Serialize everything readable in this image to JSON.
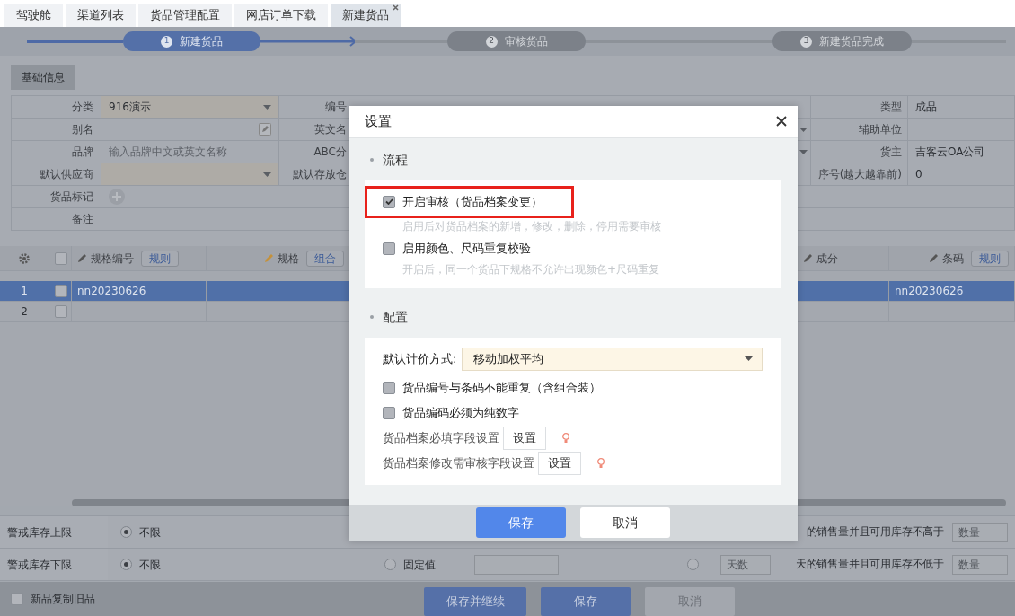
{
  "tabs": [
    {
      "label": "驾驶舱",
      "selected": false,
      "closable": false
    },
    {
      "label": "渠道列表",
      "selected": false,
      "closable": false
    },
    {
      "label": "货品管理配置",
      "selected": false,
      "closable": false
    },
    {
      "label": "网店订单下载",
      "selected": false,
      "closable": false
    },
    {
      "label": "新建货品",
      "selected": true,
      "closable": true
    }
  ],
  "steps": [
    {
      "number": "1",
      "label": "新建货品",
      "active": true
    },
    {
      "number": "2",
      "label": "审核货品",
      "active": false
    },
    {
      "number": "3",
      "label": "新建货品完成",
      "active": false
    }
  ],
  "section_tab": "基础信息",
  "form": {
    "rows": [
      {
        "label": "分类",
        "field": {
          "kind": "select",
          "value": "916演示"
        },
        "label2": "编号",
        "right_caret": false,
        "right_label": "类型",
        "right_value": "成品"
      },
      {
        "label": "别名",
        "field": {
          "kind": "edit"
        },
        "label2": "英文名",
        "right_caret": true,
        "right_label": "辅助单位"
      },
      {
        "label": "品牌",
        "field": {
          "kind": "input",
          "placeholder": "输入品牌中文或英文名称"
        },
        "label2": "ABC分",
        "right_caret": true,
        "right_label": "货主",
        "right_value": "吉客云OA公司"
      },
      {
        "label": "默认供应商",
        "field": {
          "kind": "select"
        },
        "label2": "默认存放仓",
        "right_caret": false,
        "right_label": "序号(越大越靠前)",
        "right_value": "0"
      },
      {
        "label": "货品标记",
        "field": {
          "kind": "add"
        }
      },
      {
        "label": "备注",
        "field": {
          "kind": "text"
        }
      }
    ]
  },
  "grid": {
    "select_all_checked": false,
    "columns": [
      {
        "label": "规格编号",
        "button": "规则"
      },
      {
        "label": "规格",
        "button": "组合"
      },
      {
        "label": "成分"
      },
      {
        "label": "条码",
        "button": "规则"
      }
    ],
    "rows": [
      {
        "index": "1",
        "selected": true,
        "checked": false,
        "code": "nn20230626",
        "barcode": "nn20230626"
      },
      {
        "index": "2",
        "selected": false,
        "checked": false
      }
    ]
  },
  "stock": {
    "rows": [
      {
        "label": "警戒库存上限",
        "unlimited": {
          "label": "不限",
          "selected": true
        },
        "tail": "的销售量并且可用库存不高于",
        "qty_placeholder": "数量"
      },
      {
        "label": "警戒库存下限",
        "unlimited": {
          "label": "不限",
          "selected": true
        },
        "fixed": {
          "label": "固定值",
          "selected": false
        },
        "days": {
          "selected": false,
          "placeholder": "天数"
        },
        "tail": "天的销售量并且可用库存不低于",
        "qty_placeholder": "数量"
      }
    ]
  },
  "footer": {
    "copy_old": {
      "label": "新品复制旧品",
      "checked": false
    },
    "buttons": [
      {
        "label": "保存并继续",
        "kind": "primary"
      },
      {
        "label": "保存",
        "kind": "primary"
      },
      {
        "label": "取消",
        "kind": "plain"
      }
    ]
  },
  "dialog": {
    "title": "设置",
    "sections": [
      {
        "title": "流程",
        "items": [
          {
            "kind": "checkbox",
            "label": "开启审核（货品档案变更）",
            "checked": true,
            "highlighted": true,
            "hint": "启用后对货品档案的新增，修改，删除，停用需要审核"
          },
          {
            "kind": "checkbox",
            "label": "启用颜色、尺码重复校验",
            "checked": false,
            "highlighted": false,
            "hint": "开启后，同一个货品下规格不允许出现颜色+尺码重复"
          }
        ]
      },
      {
        "title": "配置",
        "items": [
          {
            "kind": "select",
            "label": "默认计价方式:",
            "value": "移动加权平均"
          },
          {
            "kind": "checkbox",
            "label": "货品编号与条码不能重复（含组合装）",
            "checked": false,
            "highlighted": false
          },
          {
            "kind": "checkbox",
            "label": "货品编码必须为纯数字",
            "checked": false,
            "highlighted": false
          },
          {
            "kind": "setting",
            "label": "货品档案必填字段设置",
            "button": "设置"
          },
          {
            "kind": "setting",
            "label": "货品档案修改需审核字段设置",
            "button": "设置"
          }
        ]
      }
    ],
    "buttons": [
      {
        "label": "保存",
        "primary": true
      },
      {
        "label": "取消",
        "primary": false
      }
    ]
  }
}
